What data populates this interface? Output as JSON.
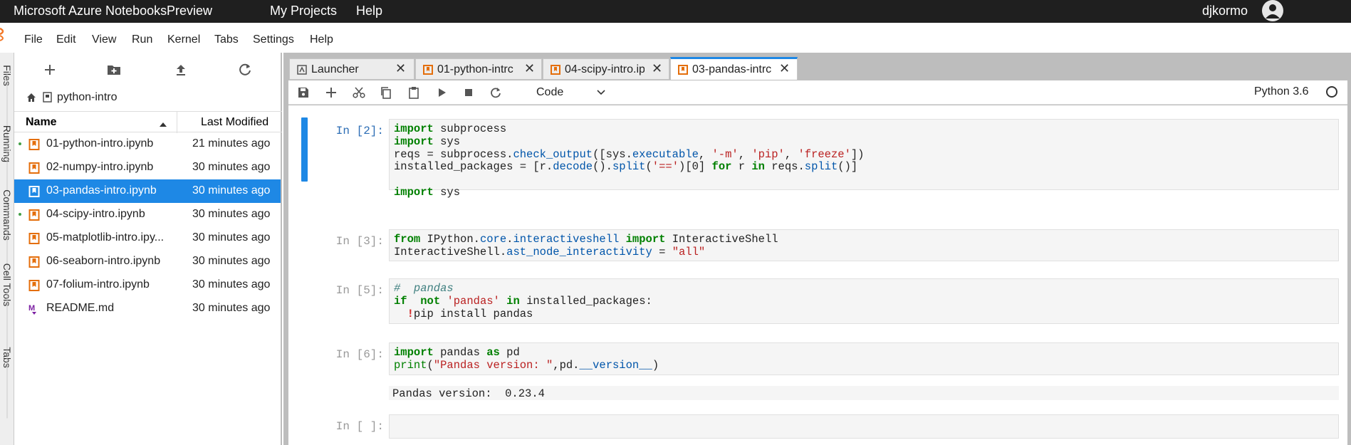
{
  "topbar": {
    "brand": "Microsoft Azure Notebooks",
    "preview": "Preview",
    "my_projects": "My Projects",
    "help": "Help",
    "user": "djkormo"
  },
  "menu": {
    "items": [
      "File",
      "Edit",
      "View",
      "Run",
      "Kernel",
      "Tabs",
      "Settings",
      "Help"
    ]
  },
  "rail": {
    "tabs": [
      "Files",
      "Running",
      "Commands",
      "Cell Tools",
      "Tabs"
    ]
  },
  "filebrowser": {
    "folder": "python-intro",
    "col_name": "Name",
    "col_modified": "Last Modified",
    "files": [
      {
        "name": "01-python-intro.ipynb",
        "time": "21 minutes ago",
        "running": true,
        "type": "notebook"
      },
      {
        "name": "02-numpy-intro.ipynb",
        "time": "30 minutes ago",
        "running": false,
        "type": "notebook"
      },
      {
        "name": "03-pandas-intro.ipynb",
        "time": "30 minutes ago",
        "running": false,
        "type": "notebook",
        "selected": true
      },
      {
        "name": "04-scipy-intro.ipynb",
        "time": "30 minutes ago",
        "running": true,
        "type": "notebook"
      },
      {
        "name": "05-matplotlib-intro.ipy...",
        "time": "30 minutes ago",
        "running": false,
        "type": "notebook"
      },
      {
        "name": "06-seaborn-intro.ipynb",
        "time": "30 minutes ago",
        "running": false,
        "type": "notebook"
      },
      {
        "name": "07-folium-intro.ipynb",
        "time": "30 minutes ago",
        "running": false,
        "type": "notebook"
      },
      {
        "name": "README.md",
        "time": "30 minutes ago",
        "running": false,
        "type": "markdown"
      }
    ]
  },
  "tabs": [
    {
      "label": "Launcher",
      "icon": "launcher-icon"
    },
    {
      "label": "01-python-intrc",
      "icon": "notebook-icon"
    },
    {
      "label": "04-scipy-intro.ip",
      "icon": "notebook-icon"
    },
    {
      "label": "03-pandas-intrc",
      "icon": "notebook-icon",
      "active": true
    }
  ],
  "notebook": {
    "cell_type": "Code",
    "kernel": "Python 3.6",
    "cells": [
      {
        "prompt": "In [2]:"
      },
      {
        "prompt": "In [3]:"
      },
      {
        "prompt": "In [5]:"
      },
      {
        "prompt": "In [6]:",
        "output": "Pandas version:  0.23.4"
      },
      {
        "prompt": "In [ ]:"
      }
    ]
  },
  "colors": {
    "accent": "#1e88e5",
    "topbar": "#1f1f1f",
    "notebook_icon": "#e46e0b",
    "running_dot": "#43a047"
  }
}
